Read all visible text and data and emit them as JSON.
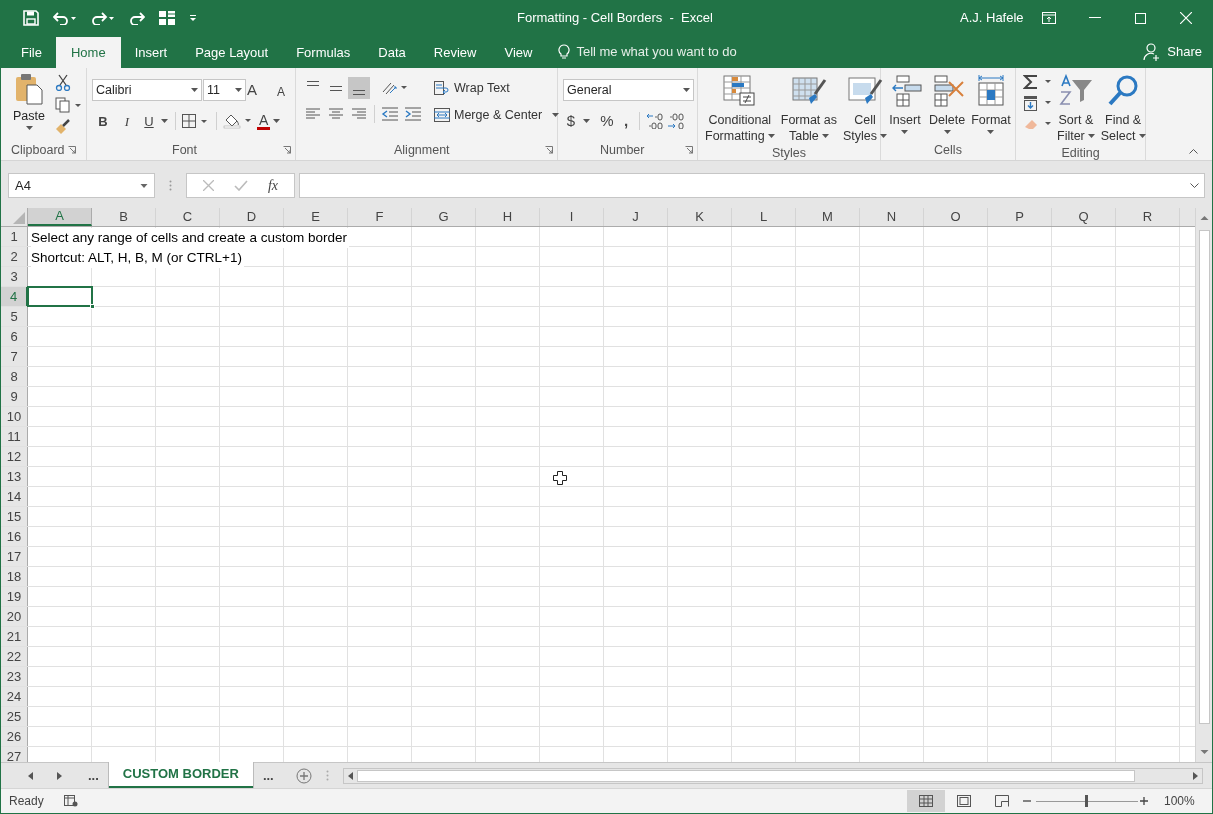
{
  "window": {
    "title": "Formatting - Cell Borders  -  Excel",
    "user": "A.J. Hafele"
  },
  "tabs": [
    {
      "label": "File",
      "selected": false
    },
    {
      "label": "Home",
      "selected": true
    },
    {
      "label": "Insert",
      "selected": false
    },
    {
      "label": "Page Layout",
      "selected": false
    },
    {
      "label": "Formulas",
      "selected": false
    },
    {
      "label": "Data",
      "selected": false
    },
    {
      "label": "Review",
      "selected": false
    },
    {
      "label": "View",
      "selected": false
    }
  ],
  "tell_me": {
    "placeholder": "Tell me what you want to do"
  },
  "share": "Share",
  "clipboard": {
    "paste": "Paste",
    "label": "Clipboard"
  },
  "font": {
    "name": "Calibri",
    "size": "11",
    "grow": "A",
    "shrink": "A",
    "bold": "B",
    "italic": "I",
    "underline": "U",
    "color_button": "A",
    "label": "Font"
  },
  "alignment": {
    "vertical_align": [
      {
        "selected": false
      },
      {
        "selected": false
      },
      {
        "selected": true
      }
    ],
    "wrap": "Wrap Text",
    "merge": "Merge & Center",
    "label": "Alignment"
  },
  "number": {
    "format": "General",
    "currency": "$",
    "percent": "%",
    "comma": ",",
    "label": "Number"
  },
  "styles": {
    "buttons": [
      {
        "lines": [
          "Conditional",
          "Formatting"
        ]
      },
      {
        "lines": [
          "Format as",
          "Table"
        ]
      },
      {
        "lines": [
          "Cell",
          "Styles"
        ]
      }
    ],
    "label": "Styles"
  },
  "cells": {
    "buttons": [
      {
        "lines": [
          "Insert"
        ]
      },
      {
        "lines": [
          "Delete"
        ]
      },
      {
        "lines": [
          "Format"
        ]
      }
    ],
    "label": "Cells"
  },
  "editing": {
    "buttons": [
      {
        "lines": [
          "Sort &",
          "Filter"
        ]
      },
      {
        "lines": [
          "Find &",
          "Select"
        ]
      }
    ],
    "label": "Editing"
  },
  "formula_bar": {
    "name_box": "A4",
    "fx": "fx"
  },
  "columns": [
    {
      "label": "A",
      "selected": true
    },
    {
      "label": "B",
      "selected": false
    },
    {
      "label": "C",
      "selected": false
    },
    {
      "label": "D",
      "selected": false
    },
    {
      "label": "E",
      "selected": false
    },
    {
      "label": "F",
      "selected": false
    },
    {
      "label": "G",
      "selected": false
    },
    {
      "label": "H",
      "selected": false
    },
    {
      "label": "I",
      "selected": false
    },
    {
      "label": "J",
      "selected": false
    },
    {
      "label": "K",
      "selected": false
    },
    {
      "label": "L",
      "selected": false
    },
    {
      "label": "M",
      "selected": false
    },
    {
      "label": "N",
      "selected": false
    },
    {
      "label": "O",
      "selected": false
    },
    {
      "label": "P",
      "selected": false
    },
    {
      "label": "Q",
      "selected": false
    },
    {
      "label": "R",
      "selected": false
    }
  ],
  "rows": [
    {
      "label": "1",
      "selected": false,
      "text": "Select any range of cells and create a custom border"
    },
    {
      "label": "2",
      "selected": false,
      "text": "Shortcut: ALT, H, B, M (or CTRL+1)"
    },
    {
      "label": "3",
      "selected": false
    },
    {
      "label": "4",
      "selected": true
    },
    {
      "label": "5",
      "selected": false
    },
    {
      "label": "6",
      "selected": false
    },
    {
      "label": "7",
      "selected": false
    },
    {
      "label": "8",
      "selected": false
    },
    {
      "label": "9",
      "selected": false
    },
    {
      "label": "10",
      "selected": false
    },
    {
      "label": "11",
      "selected": false
    },
    {
      "label": "12",
      "selected": false
    },
    {
      "label": "13",
      "selected": false
    },
    {
      "label": "14",
      "selected": false
    },
    {
      "label": "15",
      "selected": false
    },
    {
      "label": "16",
      "selected": false
    },
    {
      "label": "17",
      "selected": false
    },
    {
      "label": "18",
      "selected": false
    },
    {
      "label": "19",
      "selected": false
    },
    {
      "label": "20",
      "selected": false
    },
    {
      "label": "21",
      "selected": false
    },
    {
      "label": "22",
      "selected": false
    },
    {
      "label": "23",
      "selected": false
    },
    {
      "label": "24",
      "selected": false
    },
    {
      "label": "25",
      "selected": false
    },
    {
      "label": "26",
      "selected": false
    },
    {
      "label": "27",
      "selected": false
    }
  ],
  "sheet_tabs": [
    {
      "label": "...",
      "selected": false
    },
    {
      "label": "CUSTOM BORDER",
      "selected": true
    },
    {
      "label": "...",
      "selected": false
    }
  ],
  "status": {
    "text": "Ready",
    "views": [
      {
        "selected": true
      },
      {
        "selected": false
      },
      {
        "selected": false
      }
    ],
    "zoom": {
      "level": 0.5,
      "reading": "100%"
    }
  }
}
